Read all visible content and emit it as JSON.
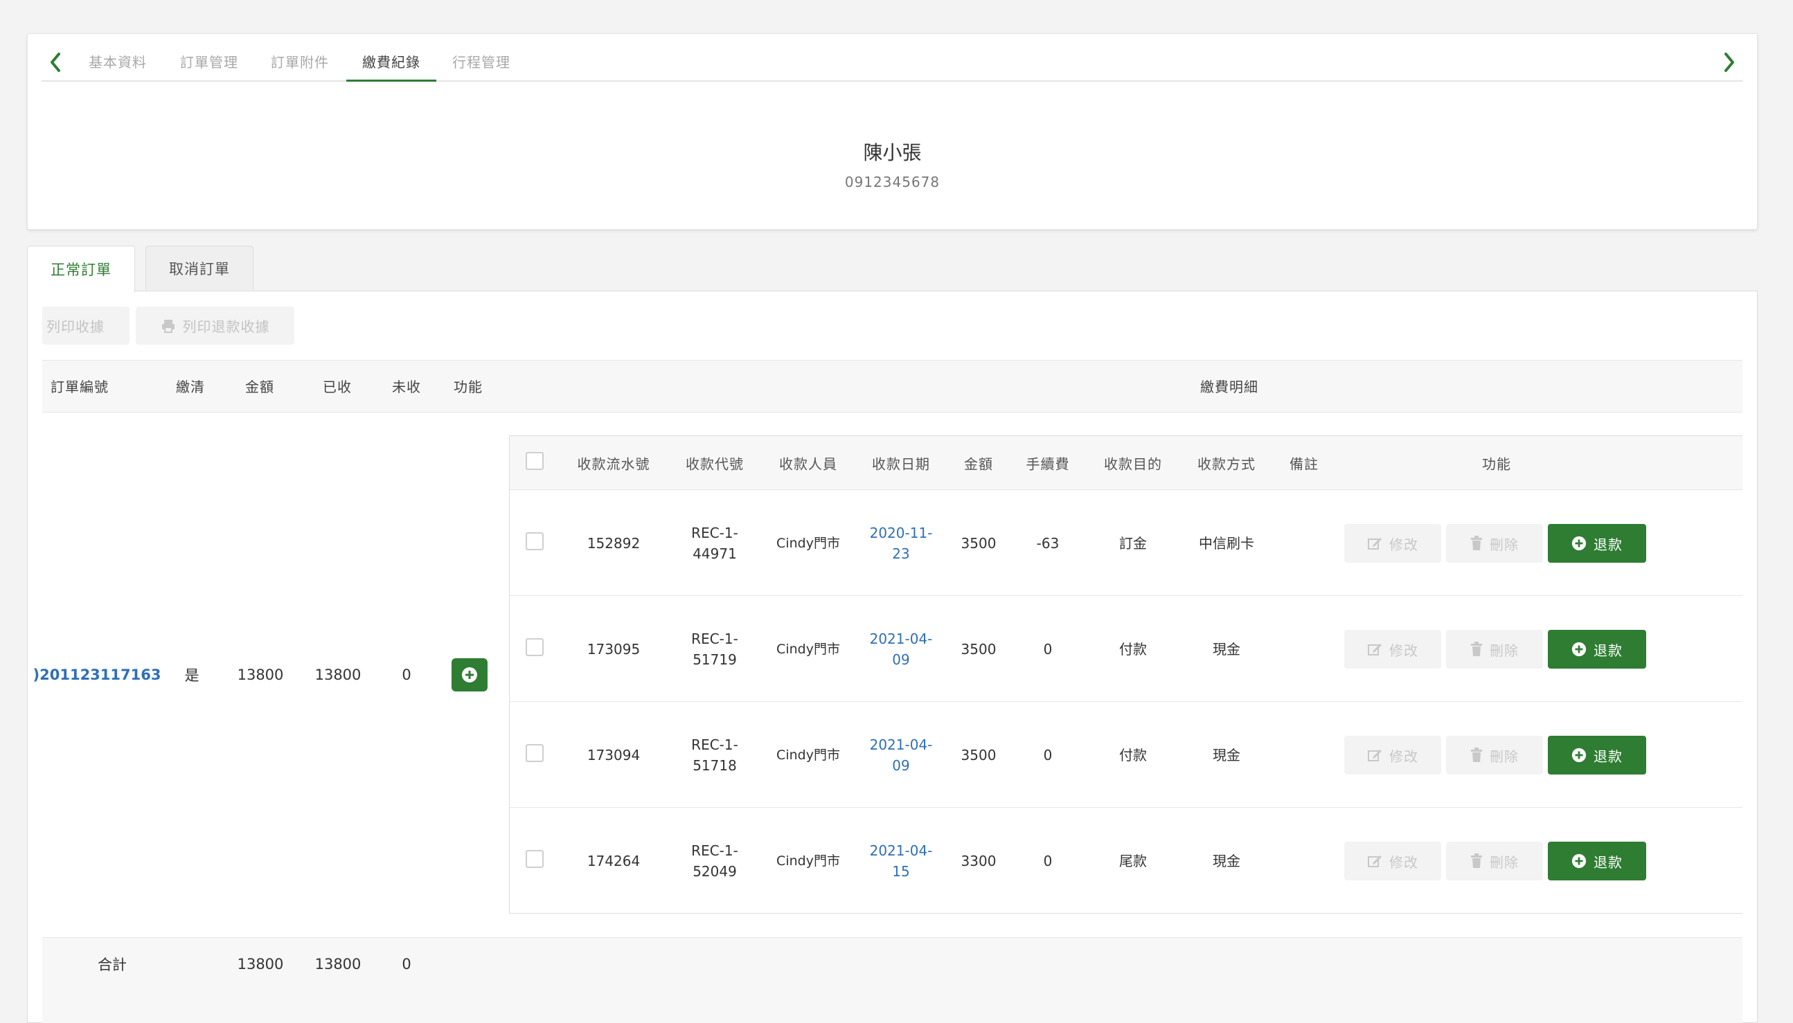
{
  "nav_tabs": [
    "基本資料",
    "訂單管理",
    "訂單附件",
    "繳費紀錄",
    "行程管理"
  ],
  "active_tab": "繳費紀錄",
  "customer": {
    "name": "陳小張",
    "phone": "0912345678"
  },
  "order_tabs": {
    "normal": "正常訂單",
    "cancelled": "取消訂單"
  },
  "buttons": {
    "print_receipt": "列印收據",
    "print_refund_receipt": "列印退款收據"
  },
  "outer_headers": {
    "order_no": "訂單編號",
    "paid_off": "繳清",
    "amount": "金額",
    "received": "已收",
    "unpaid": "未收",
    "function": "功能",
    "payment_detail": "繳費明細"
  },
  "order": {
    "order_no": ")201123117163",
    "paid_off": "是",
    "amount": "13800",
    "received": "13800",
    "unpaid": "0"
  },
  "inner_headers": {
    "serial": "收款流水號",
    "code": "收款代號",
    "staff": "收款人員",
    "date": "收款日期",
    "amount": "金額",
    "fee": "手續費",
    "purpose": "收款目的",
    "method": "收款方式",
    "note": "備註",
    "function": "功能"
  },
  "payments": [
    {
      "serial": "152892",
      "code_1": "REC-1-",
      "code_2": "44971",
      "staff": "Cindy門市",
      "date_1": "2020-11-",
      "date_2": "23",
      "amount": "3500",
      "fee": "-63",
      "purpose": "訂金",
      "method": "中信刷卡",
      "note": ""
    },
    {
      "serial": "173095",
      "code_1": "REC-1-",
      "code_2": "51719",
      "staff": "Cindy門市",
      "date_1": "2021-04-",
      "date_2": "09",
      "amount": "3500",
      "fee": "0",
      "purpose": "付款",
      "method": "現金",
      "note": ""
    },
    {
      "serial": "173094",
      "code_1": "REC-1-",
      "code_2": "51718",
      "staff": "Cindy門市",
      "date_1": "2021-04-",
      "date_2": "09",
      "amount": "3500",
      "fee": "0",
      "purpose": "付款",
      "method": "現金",
      "note": ""
    },
    {
      "serial": "174264",
      "code_1": "REC-1-",
      "code_2": "52049",
      "staff": "Cindy門市",
      "date_1": "2021-04-",
      "date_2": "15",
      "amount": "3300",
      "fee": "0",
      "purpose": "尾款",
      "method": "現金",
      "note": ""
    }
  ],
  "row_actions": {
    "edit": "修改",
    "delete": "刪除",
    "refund": "退款"
  },
  "totals": {
    "label": "合計",
    "amount": "13800",
    "received": "13800",
    "unpaid": "0"
  },
  "colors": {
    "accent": "#2e7d32",
    "link": "#2e6fb7"
  }
}
